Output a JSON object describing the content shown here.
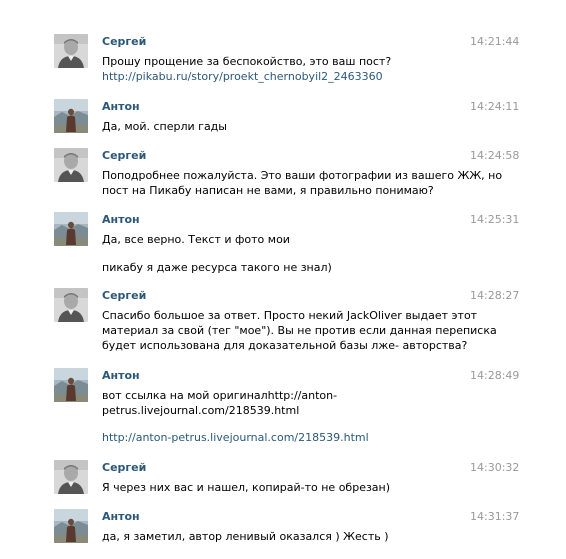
{
  "messages": [
    {
      "author": "Сергей",
      "avatar_icon": "user-photo-sergey-icon",
      "time": "14:21:44",
      "lines": [
        {
          "text": "Прошу прощение за беспокойство, это ваш пост?",
          "link": false
        },
        {
          "text": "http://pikabu.ru/story/proekt_chernobyil2_2463360",
          "link": true
        }
      ]
    },
    {
      "author": "Антон",
      "avatar_icon": "user-photo-anton-icon",
      "time": "14:24:11",
      "lines": [
        {
          "text": "Да, мой. сперли гады",
          "link": false
        }
      ]
    },
    {
      "author": "Сергей",
      "avatar_icon": "user-photo-sergey-icon",
      "time": "14:24:58",
      "lines": [
        {
          "text": "Поподробнее пожалуйста. Это ваши фотографии из вашего ЖЖ, но",
          "link": false
        },
        {
          "text": "пост на Пикабу написан не вами, я правильно понимаю?",
          "link": false
        }
      ]
    },
    {
      "author": "Антон",
      "avatar_icon": "user-photo-anton-icon",
      "time": "14:25:31",
      "lines": [
        {
          "text": "Да, все верно. Текст и фото мои",
          "link": false
        },
        {
          "text": "пикабу я даже ресурса такого не знал)",
          "link": false
        }
      ]
    },
    {
      "author": "Сергей",
      "avatar_icon": "user-photo-sergey-icon",
      "time": "14:28:27",
      "lines": [
        {
          "text": "Спасибо большое за ответ. Просто некий JackOliver выдает этот",
          "link": false
        },
        {
          "text": "материал за свой (тег \"мое\"). Вы не против если данная переписка",
          "link": false
        },
        {
          "text": "будет использована для доказательной базы лже- авторства?",
          "link": false
        }
      ]
    },
    {
      "author": "Антон",
      "avatar_icon": "user-photo-anton-icon",
      "time": "14:28:49",
      "lines": [
        {
          "text": "вот ссылка на мой оригиналhttp://anton-",
          "link": false
        },
        {
          "text": "petrus.livejournal.com/218539.html",
          "link": false
        },
        {
          "text": "http://anton-petrus.livejournal.com/218539.html",
          "link": true
        }
      ]
    },
    {
      "author": "Сергей",
      "avatar_icon": "user-photo-sergey-icon",
      "time": "14:30:32",
      "lines": [
        {
          "text": "Я через них вас и нашел, копирай-то не обрезан)",
          "link": false
        }
      ]
    },
    {
      "author": "Антон",
      "avatar_icon": "user-photo-anton-icon",
      "time": "14:31:37",
      "lines": [
        {
          "text": "да, я заметил, автор ленивый оказался ) Жесть )",
          "link": false
        }
      ]
    }
  ],
  "colors": {
    "author": "#2b587a",
    "link": "#2b587a",
    "time": "#999999",
    "text": "#000000"
  }
}
